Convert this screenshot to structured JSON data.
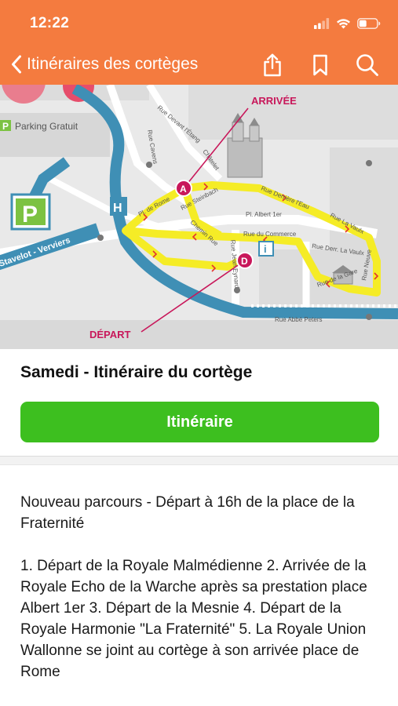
{
  "status_bar": {
    "time": "12:22",
    "icons": [
      "signal-icon",
      "wifi-icon",
      "battery-icon"
    ]
  },
  "nav": {
    "back_icon": "chevron-left-icon",
    "title": "Itinéraires des cortèges",
    "actions": [
      "share-icon",
      "bookmark-icon",
      "search-icon"
    ]
  },
  "map": {
    "labels": {
      "arrivee": "ARRIVÉE",
      "depart": "DÉPART",
      "parking": "Parking Gratuit",
      "parking_symbol": "P",
      "hospital_symbol": "H",
      "info_symbol": "i",
      "marker_a": "A",
      "marker_d": "D",
      "stavelot": "Stavelot - Verviers",
      "rue_depart_etang": "Rue Devant l'Étang",
      "chatelet": "Châtelet",
      "rue_cavens": "Rue Cavens",
      "pl_de_rome": "Pl. de Rome",
      "rue_steinbach": "Rue Steinbach",
      "chemin_rue": "Chemin Rue",
      "pl_albert": "Pl. Albert 1er",
      "rue_derriere_leau": "Rue Derrière l'Eau",
      "rue_la_vaulx": "Rue La Vaulx",
      "rue_du_commerce": "Rue du Commerce",
      "rue_derr_la_vaulx": "Rue Derr. La Vaulx",
      "rue_de_la_gare": "Rue de la Gare",
      "rue_neuve": "Rue Neuve",
      "rue_jean_eynard": "Rue Jean Eynard",
      "rue_abbe_peters": "Rue Abbé Peters"
    },
    "colors": {
      "route": "#f5ec26",
      "river": "#3f8fb5",
      "marker": "#c8175a",
      "parking": "#7cc242"
    }
  },
  "section": {
    "title": "Samedi - Itinéraire du cortège",
    "button_label": "Itinéraire",
    "button_color": "#3dbf1f"
  },
  "description": {
    "paragraphs": [
      "Nouveau parcours - Départ à 16h de la place de la Fraternité",
      "1. Départ de la Royale Malmédienne 2. Arrivée de la Royale Echo de la Warche après sa prestation place Albert 1er  3. Départ de la Mesnie  4. Départ de la Royale Harmonie \"La Fraternité\"  5. La Royale Union Wallonne se joint au cortège à son arrivée place de Rome"
    ]
  },
  "theme": {
    "header_color": "#f47b3f"
  }
}
